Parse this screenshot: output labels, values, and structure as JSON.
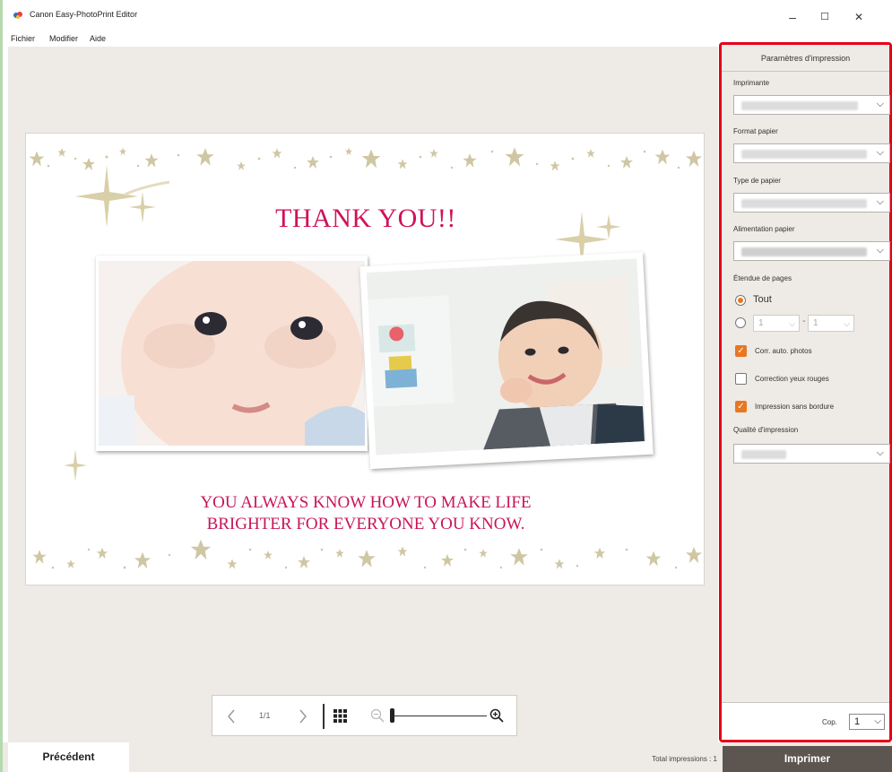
{
  "app": {
    "title": "Canon Easy-PhotoPrint Editor"
  },
  "window_controls": {
    "minimize": "–",
    "maximize": "☐",
    "close": "✕"
  },
  "menu": [
    "Fichier",
    "Modifier",
    "Aide"
  ],
  "card": {
    "title": "THANK YOU!!",
    "message_line1": "YOU ALWAYS KNOW HOW TO MAKE LIFE",
    "message_line2": "BRIGHTER FOR EVERYONE YOU KNOW."
  },
  "viewbar": {
    "page": "1/1",
    "zoom_fraction": 0.0
  },
  "footer": {
    "prev_label": "Précédent",
    "total_label": "Total impressions : 1",
    "print_label": "Imprimer"
  },
  "panel": {
    "header": "Paramètres d'impression",
    "printer_label": "Imprimante",
    "paper_size_label": "Format papier",
    "paper_type_label": "Type de papier",
    "paper_source_label": "Alimentation papier",
    "page_range_label": "Étendue de pages",
    "range_all": "Tout",
    "range_from": "1",
    "range_to": "1",
    "range_sep": "-",
    "auto_correct_label": "Corr. auto. photos",
    "auto_correct_checked": true,
    "redeye_label": "Correction yeux rouges",
    "redeye_checked": false,
    "borderless_label": "Impression sans bordure",
    "borderless_checked": true,
    "quality_label": "Qualité d'impression",
    "copies_label": "Cop.",
    "copies_value": "1"
  },
  "colors": {
    "accent": "#e3001b",
    "title_pink": "#d0125a",
    "check_orange": "#e87722",
    "print_button": "#5c5550"
  },
  "icons": [
    "app-logo-icon",
    "chevron-left-icon",
    "chevron-right-icon",
    "grid-icon",
    "zoom-out-icon",
    "zoom-in-icon",
    "chevron-down-icon"
  ]
}
